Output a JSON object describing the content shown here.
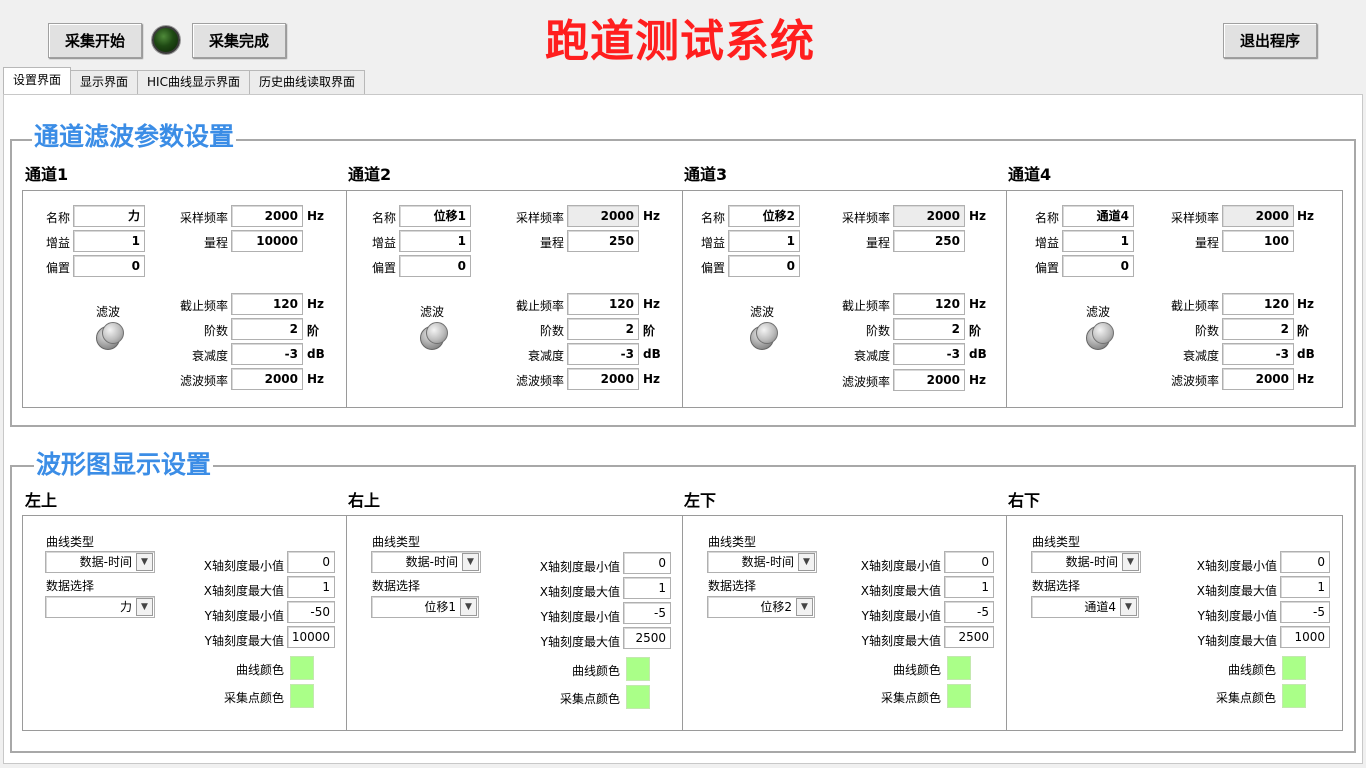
{
  "window": {
    "title": "跑道测试系统"
  },
  "toolbar": {
    "start_label": "采集开始",
    "done_label": "采集完成",
    "exit_label": "退出程序"
  },
  "tabs": [
    {
      "label": "设置界面"
    },
    {
      "label": "显示界面"
    },
    {
      "label": "HIC曲线显示界面"
    },
    {
      "label": "历史曲线读取界面"
    }
  ],
  "filter_settings": {
    "title": "通道滤波参数设置",
    "labels": {
      "name": "名称",
      "gain": "增益",
      "offset": "偏置",
      "sample_rate": "采样频率",
      "range": "量程",
      "filter": "滤波",
      "cutoff": "截止频率",
      "order": "阶数",
      "attenuation": "衰减度",
      "filter_rate": "滤波频率"
    },
    "units": {
      "hz": "Hz",
      "order": "阶",
      "db": "dB"
    },
    "channels": [
      {
        "heading": "通道1",
        "name": "力",
        "gain": "1",
        "offset": "0",
        "sample_rate": "2000",
        "range": "10000",
        "cutoff": "120",
        "order": "2",
        "attenuation": "-3",
        "filter_rate": "2000"
      },
      {
        "heading": "通道2",
        "name": "位移1",
        "gain": "1",
        "offset": "0",
        "sample_rate": "2000",
        "range": "250",
        "cutoff": "120",
        "order": "2",
        "attenuation": "-3",
        "filter_rate": "2000"
      },
      {
        "heading": "通道3",
        "name": "位移2",
        "gain": "1",
        "offset": "0",
        "sample_rate": "2000",
        "range": "250",
        "cutoff": "120",
        "order": "2",
        "attenuation": "-3",
        "filter_rate": "2000"
      },
      {
        "heading": "通道4",
        "name": "通道4",
        "gain": "1",
        "offset": "0",
        "sample_rate": "2000",
        "range": "100",
        "cutoff": "120",
        "order": "2",
        "attenuation": "-3",
        "filter_rate": "2000"
      }
    ]
  },
  "waveform_settings": {
    "title": "波形图显示设置",
    "labels": {
      "curve_type": "曲线类型",
      "data_select": "数据选择",
      "x_min": "X轴刻度最小值",
      "x_max": "X轴刻度最大值",
      "y_min": "Y轴刻度最小值",
      "y_max": "Y轴刻度最大值",
      "curve_color": "曲线颜色",
      "point_color": "采集点颜色"
    },
    "panels": [
      {
        "heading": "左上",
        "curve_type": "数据-时间",
        "data_select": "力",
        "x_min": "0",
        "x_max": "1",
        "y_min": "-50",
        "y_max": "10000",
        "curve_color": "#aaff88",
        "point_color": "#aaff88"
      },
      {
        "heading": "右上",
        "curve_type": "数据-时间",
        "data_select": "位移1",
        "x_min": "0",
        "x_max": "1",
        "y_min": "-5",
        "y_max": "2500",
        "curve_color": "#aaff88",
        "point_color": "#aaff88"
      },
      {
        "heading": "左下",
        "curve_type": "数据-时间",
        "data_select": "位移2",
        "x_min": "0",
        "x_max": "1",
        "y_min": "-5",
        "y_max": "2500",
        "curve_color": "#aaff88",
        "point_color": "#aaff88"
      },
      {
        "heading": "右下",
        "curve_type": "数据-时间",
        "data_select": "通道4",
        "x_min": "0",
        "x_max": "1",
        "y_min": "-5",
        "y_max": "1000",
        "curve_color": "#aaff88",
        "point_color": "#aaff88"
      }
    ]
  }
}
